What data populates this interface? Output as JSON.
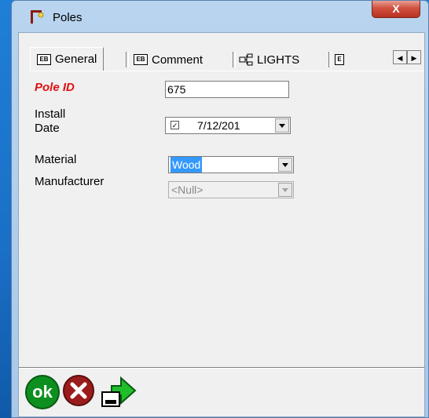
{
  "window": {
    "title": "Poles",
    "close_label": "X"
  },
  "tabs": [
    {
      "label": "General",
      "icon": "form-icon",
      "active": true
    },
    {
      "label": "Comment",
      "icon": "form-icon",
      "active": false
    },
    {
      "label": "LIGHTS",
      "icon": "tree-icon",
      "active": false
    }
  ],
  "fields": {
    "pole_id": {
      "label": "Pole ID",
      "value": "675"
    },
    "install_date": {
      "label_line1": "Install",
      "label_line2": "Date",
      "value": "7/12/201",
      "checked": true
    },
    "material": {
      "label": "Material",
      "value": "Wood"
    },
    "manufacturer": {
      "label": "Manufacturer",
      "value": "<Null>"
    }
  },
  "buttons": {
    "ok": "ok",
    "cancel": "cancel-icon",
    "export": "export-arrow-icon"
  },
  "colors": {
    "required_label": "#e01010",
    "ok_green": "#0c8f1e",
    "cancel_red": "#9b1c1c",
    "selection": "#3399ff"
  }
}
